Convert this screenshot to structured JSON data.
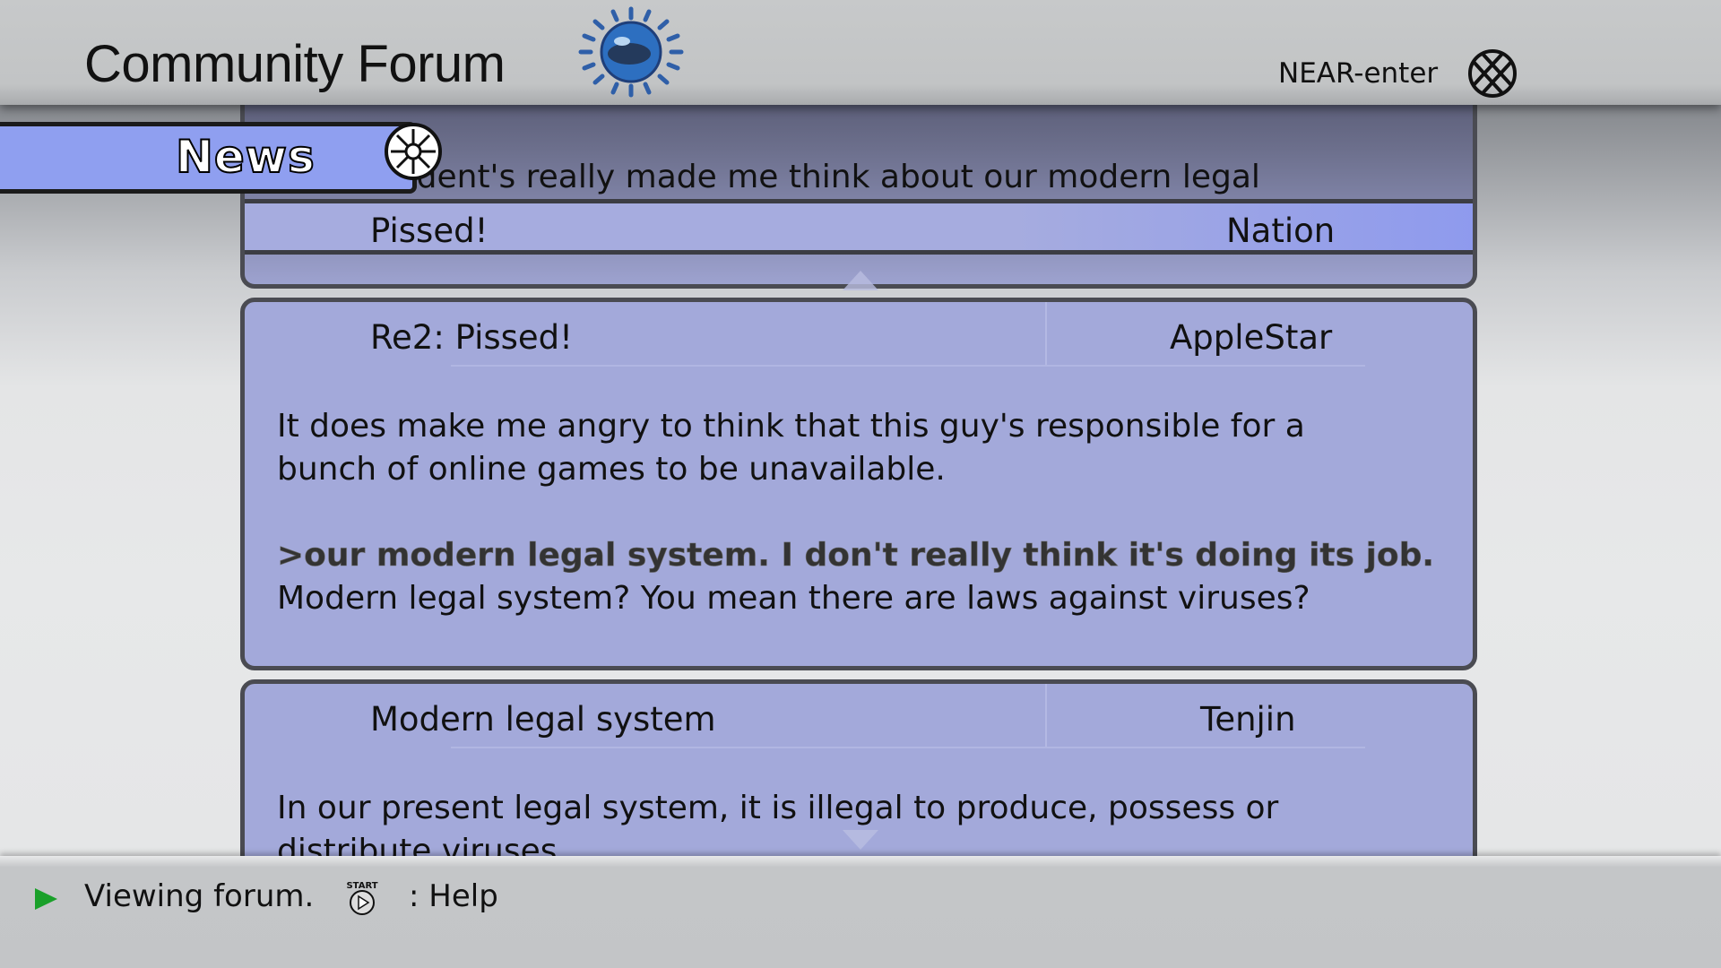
{
  "header": {
    "title": "Community Forum",
    "network_label": "NEAR-enter"
  },
  "category": {
    "label": "News"
  },
  "posts": [
    {
      "subject": "Pissed!",
      "author": "Nation",
      "preview_text": "This incident's really made me think about our modern legal"
    },
    {
      "subject": "Re2: Pissed!",
      "author": "AppleStar",
      "body": [
        "It does make me angry to think that this guy's responsible for a",
        "bunch of online games to be unavailable.",
        ">our modern legal system. I don't really think it's doing its job.",
        "Modern legal system? You mean there are laws against viruses?"
      ]
    },
    {
      "subject": "Modern legal system",
      "author": "Tenjin",
      "body": [
        "In our present legal system, it is illegal to produce, possess or",
        "distribute viruses."
      ]
    }
  ],
  "footer": {
    "status": "Viewing forum.",
    "help": ": Help",
    "start_icon_text": "START"
  },
  "colors": {
    "post_bg": "#a3a9da",
    "tab_bg": "#8f9ff0",
    "status_arrow": "#1aa02a"
  }
}
